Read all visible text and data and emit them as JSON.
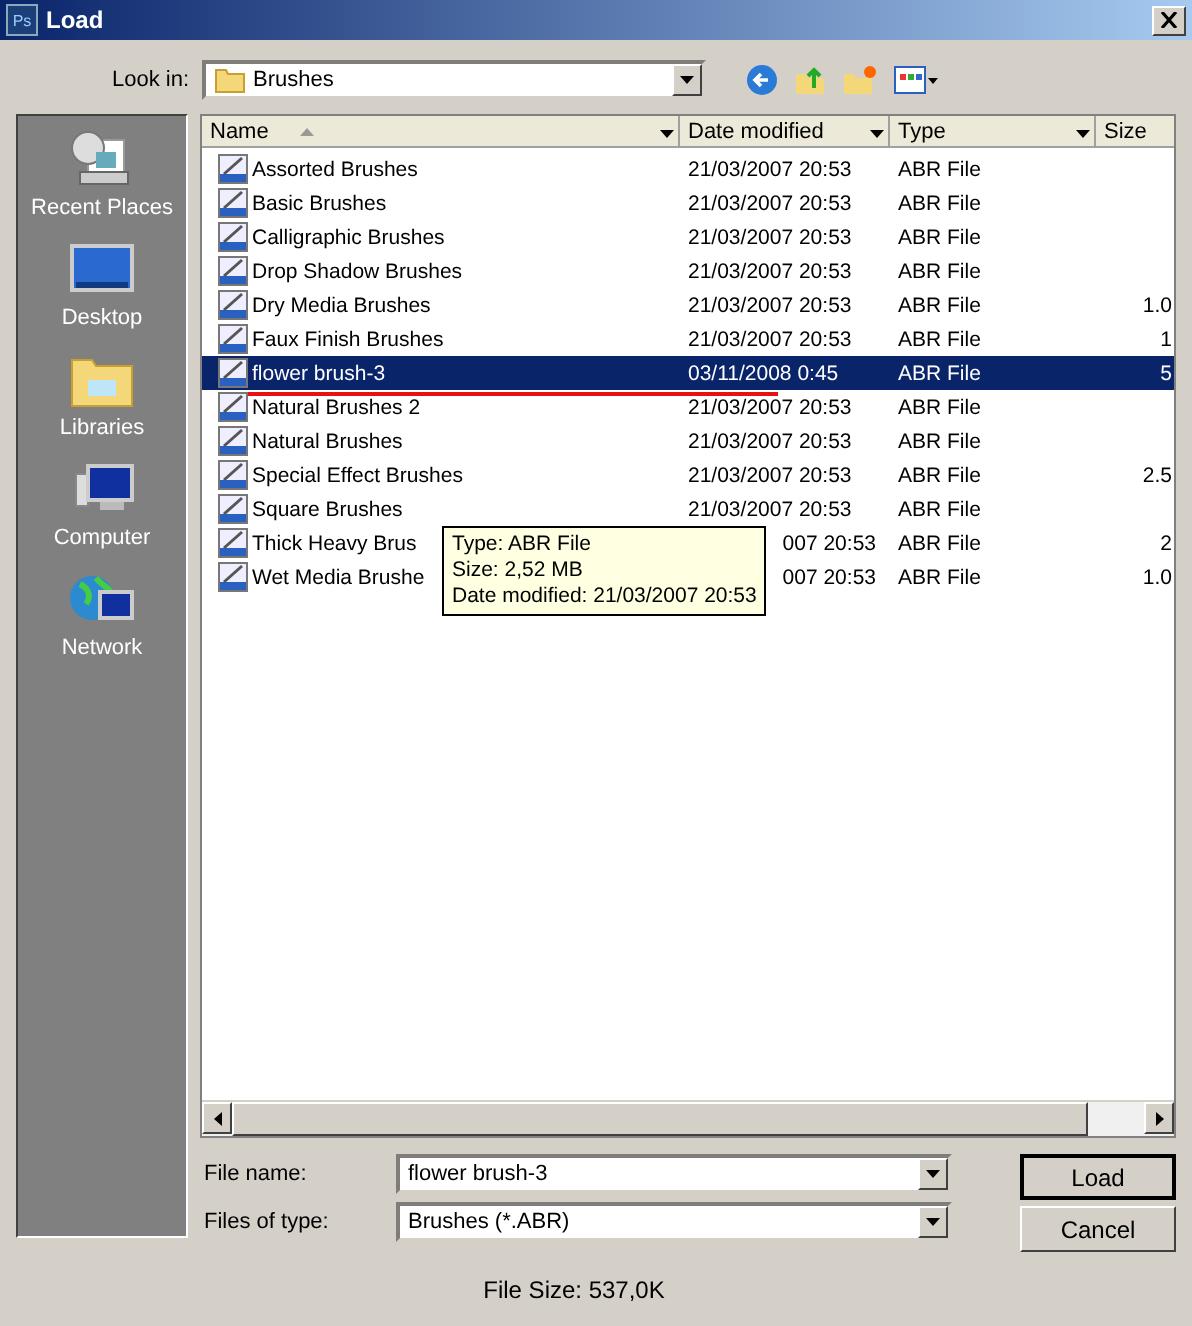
{
  "window": {
    "title": "Load",
    "app_icon": "Ps"
  },
  "look_in": {
    "label": "Look in:",
    "value": "Brushes"
  },
  "sidebar": {
    "items": [
      {
        "label": "Recent Places",
        "kind": "recent"
      },
      {
        "label": "Desktop",
        "kind": "desktop"
      },
      {
        "label": "Libraries",
        "kind": "libraries"
      },
      {
        "label": "Computer",
        "kind": "computer"
      },
      {
        "label": "Network",
        "kind": "network"
      }
    ]
  },
  "table": {
    "columns": [
      "Name",
      "Date modified",
      "Type",
      "Size"
    ],
    "rows": [
      {
        "name": "Assorted Brushes",
        "date": "21/03/2007 20:53",
        "type": "ABR File",
        "selected": false
      },
      {
        "name": "Basic Brushes",
        "date": "21/03/2007 20:53",
        "type": "ABR File",
        "selected": false
      },
      {
        "name": "Calligraphic Brushes",
        "date": "21/03/2007 20:53",
        "type": "ABR File",
        "selected": false
      },
      {
        "name": "Drop Shadow Brushes",
        "date": "21/03/2007 20:53",
        "type": "ABR File",
        "selected": false
      },
      {
        "name": "Dry Media Brushes",
        "date": "21/03/2007 20:53",
        "type": "ABR File",
        "size": "1.0",
        "selected": false
      },
      {
        "name": "Faux Finish Brushes",
        "date": "21/03/2007 20:53",
        "type": "ABR File",
        "size": "1",
        "selected": false
      },
      {
        "name": "flower brush-3",
        "date": "03/11/2008 0:45",
        "type": "ABR File",
        "size": "5",
        "selected": true,
        "underlined": true
      },
      {
        "name": "Natural Brushes 2",
        "date": "21/03/2007 20:53",
        "type": "ABR File",
        "selected": false
      },
      {
        "name": "Natural Brushes",
        "date": "21/03/2007 20:53",
        "type": "ABR File",
        "selected": false
      },
      {
        "name": "Special Effect Brushes",
        "date": "21/03/2007 20:53",
        "type": "ABR File",
        "size": "2.5",
        "selected": false
      },
      {
        "name": "Square Brushes",
        "date": "21/03/2007 20:53",
        "type": "ABR File",
        "selected": false
      },
      {
        "name": "Thick Heavy Brus",
        "date": "007 20:53",
        "type": "ABR File",
        "size": "2",
        "selected": false,
        "covered": true
      },
      {
        "name": "Wet Media Brushe",
        "date": "007 20:53",
        "type": "ABR File",
        "size": "1.0",
        "selected": false,
        "covered": true
      }
    ]
  },
  "tooltip": {
    "lines": [
      "Type: ABR File",
      "Size: 2,52 MB",
      "Date modified: 21/03/2007 20:53"
    ]
  },
  "file_name": {
    "label": "File name:",
    "value": "flower brush-3"
  },
  "file_type": {
    "label": "Files of type:",
    "value": "Brushes (*.ABR)"
  },
  "buttons": [
    "Load",
    "Cancel"
  ],
  "status": "File Size: 537,0K"
}
